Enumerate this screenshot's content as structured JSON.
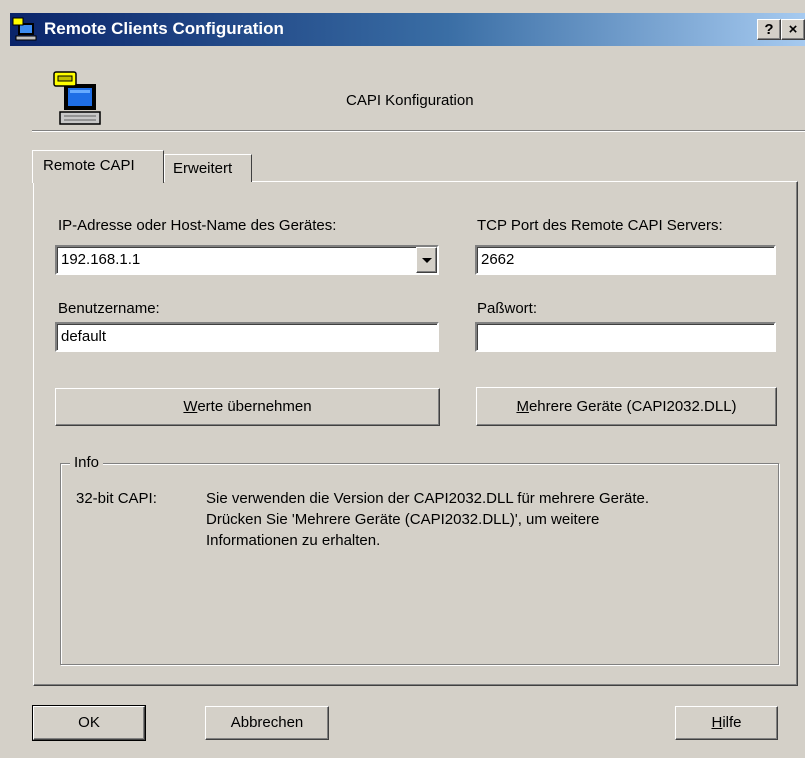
{
  "window": {
    "title": "Remote Clients Configuration",
    "help_glyph": "?",
    "close_glyph": "×"
  },
  "header": {
    "title": "CAPI Konfiguration",
    "icon": "phone-computer-icon"
  },
  "tabs": [
    {
      "label": "Remote CAPI",
      "active": true
    },
    {
      "label": "Erweitert",
      "active": false
    }
  ],
  "form": {
    "ip_label": "IP-Adresse oder Host-Name des Gerätes:",
    "ip_value": "192.168.1.1",
    "port_label": "TCP Port des Remote CAPI Servers:",
    "port_value": "2662",
    "user_label": "Benutzername:",
    "user_value": "default",
    "password_label": "Paßwort:",
    "password_value": ""
  },
  "buttons": {
    "apply_mnemonic": "W",
    "apply_rest": "erte übernehmen",
    "multi_mnemonic": "M",
    "multi_rest": "ehrere Geräte (CAPI2032.DLL)",
    "ok": "OK",
    "cancel": "Abbrechen",
    "help_mnemonic": "H",
    "help_rest": "ilfe"
  },
  "info": {
    "group_title": "Info",
    "key": "32-bit CAPI:",
    "line1": "Sie verwenden die Version der CAPI2032.DLL für mehrere Geräte.",
    "line2": "Drücken Sie 'Mehrere Geräte (CAPI2032.DLL)', um weitere",
    "line3": "Informationen zu erhalten."
  },
  "colors": {
    "dialog_bg": "#d4d0c8",
    "title_start": "#0a246a",
    "title_end": "#a6caf0"
  }
}
